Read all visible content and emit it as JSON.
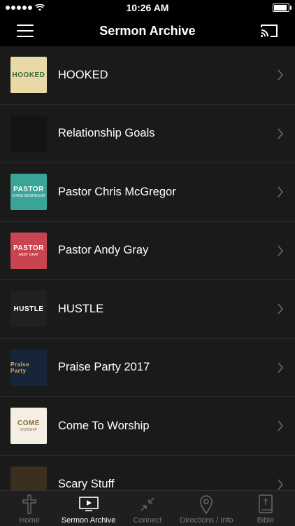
{
  "status_bar": {
    "time": "10:26 AM",
    "battery_level": 0.95
  },
  "nav": {
    "title": "Sermon Archive",
    "menu_icon": "hamburger-menu-icon",
    "cast_icon": "cast-icon"
  },
  "sermons": [
    {
      "label": "HOOKED",
      "thumb_text": "HOOKED",
      "thumb_bg": "#e8d9a6",
      "thumb_fg": "#3b6b3b"
    },
    {
      "label": "Relationship Goals",
      "thumb_text": "",
      "thumb_bg": "#141414",
      "thumb_fg": "#cccccc"
    },
    {
      "label": "Pastor Chris McGregor",
      "thumb_text": "PASTOR",
      "thumb_sub": "CHRIS MCGREGOR",
      "thumb_bg": "#3aa597",
      "thumb_fg": "#ffffff"
    },
    {
      "label": "Pastor Andy Gray",
      "thumb_text": "PASTOR",
      "thumb_sub": "ANDY GRAY",
      "thumb_bg": "#c8444f",
      "thumb_fg": "#ffffff"
    },
    {
      "label": "HUSTLE",
      "thumb_text": "HUSTLE",
      "thumb_bg": "#202020",
      "thumb_fg": "#ffffff"
    },
    {
      "label": "Praise Party 2017",
      "thumb_text": "Praise Party",
      "thumb_bg": "#16253a",
      "thumb_fg": "#e0b34e"
    },
    {
      "label": "Come To Worship",
      "thumb_text": "COME",
      "thumb_sub": "WORSHIP",
      "thumb_bg": "#f4efe2",
      "thumb_fg": "#8a6a3a"
    },
    {
      "label": "Scary Stuff",
      "thumb_text": "",
      "thumb_bg": "#3b2e1e",
      "thumb_fg": "#cfa35a"
    }
  ],
  "tabs": [
    {
      "label": "Home",
      "icon": "cross-icon",
      "active": false
    },
    {
      "label": "Sermon Archive",
      "icon": "video-screen-icon",
      "active": true
    },
    {
      "label": "Connect",
      "icon": "connect-arrows-icon",
      "active": false
    },
    {
      "label": "Directions / Info",
      "icon": "map-pin-icon",
      "active": false
    },
    {
      "label": "Bible",
      "icon": "bible-icon",
      "active": false
    }
  ]
}
